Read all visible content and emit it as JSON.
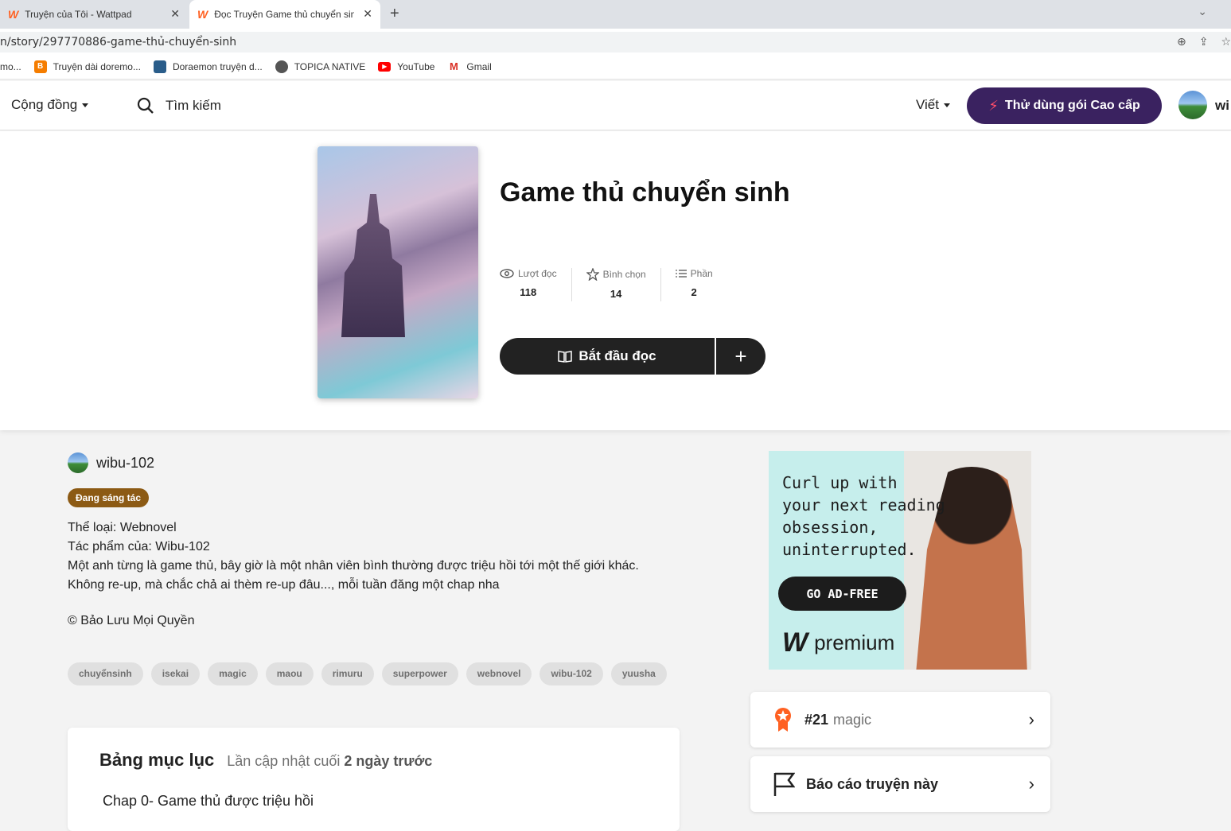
{
  "browser": {
    "tabs": [
      {
        "title": "Truyện của Tôi - Wattpad",
        "active": false
      },
      {
        "title": "Đọc Truyện Game thủ chuyển sinh",
        "active": true
      }
    ],
    "url": "n/story/297770886-game-thủ-chuyển-sinh",
    "bookmarks": [
      {
        "label": "mo...",
        "icon": "globe-icon"
      },
      {
        "label": "Truyện dài doremo...",
        "icon": "blogger-icon"
      },
      {
        "label": "Doraemon truyện d...",
        "icon": "site-icon"
      },
      {
        "label": "TOPICA NATIVE",
        "icon": "globe-icon"
      },
      {
        "label": "YouTube",
        "icon": "youtube-icon"
      },
      {
        "label": "Gmail",
        "icon": "gmail-icon"
      }
    ]
  },
  "header": {
    "community": "Cộng đồng",
    "search": "Tìm kiếm",
    "write": "Viết",
    "premium_btn": "Thử dùng gói Cao cấp",
    "user_partial": "wi"
  },
  "story": {
    "title": "Game thủ chuyển sinh",
    "stats": [
      {
        "label": "Lượt đọc",
        "value": "118",
        "icon": "eye-icon"
      },
      {
        "label": "Bình chọn",
        "value": "14",
        "icon": "star-icon"
      },
      {
        "label": "Phần",
        "value": "2",
        "icon": "list-icon"
      }
    ],
    "read_btn": "Bắt đầu đọc",
    "author": "wibu-102",
    "status_badge": "Đang sáng tác",
    "description": [
      "Thể loại: Webnovel",
      "Tác phẩm của: Wibu-102",
      "Một anh từng là game thủ, bây giờ là một nhân viên bình thường được triệu hồi tới một thế giới khác.",
      "Không re-up, mà chắc chả ai thèm re-up đâu..., mỗi tuần đăng một chap nha"
    ],
    "copyright": "© Bảo Lưu Mọi Quyền",
    "tags": [
      "chuyểnsinh",
      "isekai",
      "magic",
      "maou",
      "rimuru",
      "superpower",
      "webnovel",
      "wibu-102",
      "yuusha"
    ]
  },
  "toc": {
    "title": "Bảng mục lục",
    "updated_prefix": "Lần cập nhật cuối",
    "updated_value": "2 ngày trước",
    "items": [
      "Chap 0- Game thủ được triệu hồi"
    ]
  },
  "ad": {
    "text_lines": [
      "Curl up with",
      "your next reading",
      "obsession,",
      "uninterrupted."
    ],
    "button": "GO AD-FREE",
    "logo_text": "premium"
  },
  "sidebar": {
    "rank": "#21",
    "rank_tag": "magic",
    "report": "Báo cáo truyện này"
  }
}
